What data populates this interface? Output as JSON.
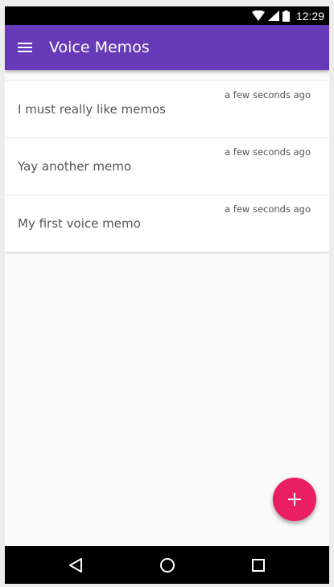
{
  "status_bar": {
    "time": "12:29",
    "icons": [
      "wifi-icon",
      "cell-signal-icon",
      "battery-icon"
    ]
  },
  "app_bar": {
    "title": "Voice Memos",
    "menu_icon": "hamburger-menu-icon",
    "color": "#673ab7"
  },
  "memos": [
    {
      "title": "I must really like memos",
      "time": "a few seconds ago"
    },
    {
      "title": "Yay another memo",
      "time": "a few seconds ago"
    },
    {
      "title": "My first voice memo",
      "time": "a few seconds ago"
    }
  ],
  "fab": {
    "icon": "plus-icon",
    "color": "#e91e63"
  },
  "nav_bar": {
    "icons": [
      "back-icon",
      "home-icon",
      "recents-icon"
    ]
  }
}
